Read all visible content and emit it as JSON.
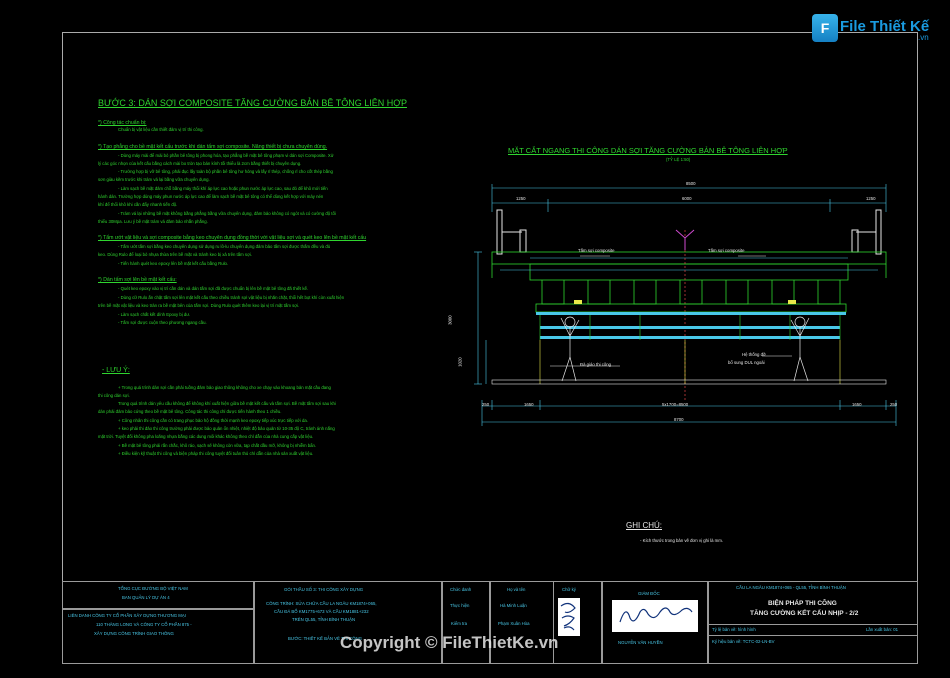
{
  "logo": {
    "mark": "F",
    "text": "File Thiết Kế",
    "suffix": ".vn"
  },
  "watermark": "Copyright © FileThietKe.vn",
  "left": {
    "heading": "BƯỚC 3: DÁN SỢI COMPOSITE TĂNG CƯỜNG BẢN BÊ TÔNG LIÊN HỢP",
    "s1_title": "*) Công tác chuẩn bị:",
    "s1_l1": "Chuẩn bị vật liệu cần thiết đảm vị trí thi công.",
    "s2_title": "*) Tạo phẳng cho bề mặt kết cấu trước khi dán tấm sợi composite. Năng thiết bị chưa chuyên dùng.",
    "s2_l1": "- Dùng máy mài để mài bỏ phần bê tông bị phong hóa, tạo phẳng bề mặt bê tông phạm vi dán sợi Composite. Xử",
    "s2_l2": "lý các góc nhọn của kết cấu bằng cách mài bo tròn tạo bán kính tối thiểu là 2cm bằng thiết bị chuyên dụng.",
    "s2_l3": "- Trường hợp bị vỡ bê tông, phải đục lấy toàn bộ phần bê tông hư hỏng và lấy rỉ thép, chống rỉ cho cốt thép bằng",
    "s2_l4": "sơn giàu kẽm trước khi trám vá lại bằng vữa chuyên dụng.",
    "s2_l5": "- Làm sạch bề mặt đảm chỗ bằng máy thổi khí áp lực cao hoặc phun nước áp lực cao, sau đó để khô mới tiến",
    "s2_l6": "hành dán. Trường hợp dùng máy phun nước áp lực cao để làm sạch bề mặt bê tông có thể dùng kết hợp với máy nén",
    "s2_l7": "khí để thổi khô khi cần đẩy nhanh tiến độ.",
    "s2_l8": "- Trám vá lại những bề mặt không bằng phẳng bằng vữa chuyên dụng, đảm bảo không có ngót và có cường độ tối",
    "s2_l9": "thiểu 30Mpa. Lưu ý bề mặt trám vá đảm bảo nhẵn phẳng.",
    "s3_title": "*) Tẩm ướt vật liệu và sợi composite bằng keo chuyên dụng đồng thời với vật liệu sợi và quét keo lên bề mặt kết cấu",
    "s3_l1": "- Tấm ướt tấm sợi bằng keo chuyên dụng sử dụng ru lô-lu chuyên dụng đảm bảo tấm sợi được thấm đều và đủ",
    "s3_l2": "keo. Dùng Rulo để loại bỏ nhựa thừa trên bề mặt và tránh keo bị xả trên tấm sợi.",
    "s3_l3": "- Tiến hành quét keo epoxy lên bề mặt kết cấu bằng Rulo.",
    "s4_title": "*) Dán tấm sợi lên bề mặt kết cấu:",
    "s4_l1": "- Quét keo epoxy vào vị trí cần dán và dán tấm sợi đã được chuẩn bị lên bề mặt bê tông đã thiết kế.",
    "s4_l2": "- Dùng cữ Rulo ấn chặt tấm sợi lên mặt kết cấu theo chiều tránh sợi vật liệu bị nhăn chặt, thổi hết bọt khí còn xuất hiện",
    "s4_l3": "trên bề mặt vật liệu và keo tràn ra bề mặt bên của tấm sợi. Dùng Rulo quét thêm keo lại vị trí mặt tấm sợi.",
    "s4_l4": "- Làm sạch chất kết dính Epoxy bị dư.",
    "s4_l5": "- Tấm sợi được cuộn theo phương ngang cầu.",
    "luuy_title": "- LƯU Ý:",
    "luuy_l1": "+ Trong quá trình dán sợi cần phải tuồng đảm bảo giao thông không cho xe chạy vào khoang bản mặt cầu đang",
    "luuy_l2": "thi công dán sợi.",
    "luuy_l3": "Trong quá trình dán yêu cầu không để không khí xuất hiện giữa bề mặt kết cấu và tấm sợi. Bề mặt tấm sợi sau khi",
    "luuy_l4": "dán phải đảm bảo cứng theo bề mặt bê tông. Công tác thi công chỉ được tiến hành theo 1 chiều.",
    "luuy_l5": "+ Công nhân thi công cần có trang phục bảo hộ đồng thời mạnh keo epoxy tiếp xúc trực tiếp với da.",
    "luuy_l6": "+ keo phải thi đảo thi công trường phải được bảo quản ổn nhiệt, nhiệt độ bảo quản từ 10-35 độ C, tránh ánh nắng",
    "luuy_l7": "mặt trời. Tuyệt đối không pha loãng nhựa bằng các dung môi khác không theo chỉ dẫn của nhà cung cấp vật liệu.",
    "luuy_l8": "+ Bề mặt bê tông phải rắn chắc, khô ráo, sạch sẽ không còn vữa, tạp chất dầu mỡ, không bị nhiễm bẩn.",
    "luuy_l9": "+ Điều kiện kỹ thuật thi công và biện pháp thi công tuyệt đối tuân thủ chỉ dẫn của nhà sản xuất vật liệu."
  },
  "right": {
    "title": "MẶT CẮT NGANG THI CÔNG DÁN SỢI TĂNG CƯỜNG BẢN BÊ TÔNG LIÊN HỢP",
    "scale": "(TỶ LỆ 1:50)",
    "dim_total": "8500",
    "dim_1250a": "1250",
    "dim_6000": "6000",
    "dim_1250b": "1250",
    "label_left": "Tấm sợi composite",
    "label_right": "Tấm sợi composite",
    "label_scaffold": "Đà giáo thi công",
    "label_support": "Hệ thống đỡ",
    "label_support2": "bổ sung DUL ngoài",
    "dim_3000": "3000",
    "dim_1020": "1020",
    "b_250a": "250",
    "b_1650a": "1650",
    "b_span": "5x1700=8500",
    "b_1650b": "1650",
    "b_250b": "250",
    "b_total": "8700"
  },
  "notes": {
    "title": "GHI CHÚ:",
    "line": "- Kích thước trong bản vẽ đơn vị ghi là mm."
  },
  "titleblock": {
    "c1_1": "TỔNG CỤC ĐƯỜNG BỘ VIỆT NAM",
    "c1_2": "BAN QUẢN LÝ DỰ ÁN 4",
    "c1_3": "LIÊN DANH CÔNG TY CỔ PHẦN XÂY DỰNG THƯƠNG MẠI",
    "c1_4": "110 THĂNG LONG VÀ CÔNG TY CỔ PHẦN 875 -",
    "c1_5": "XÂY DỰNG CÔNG TRÌNH GIAO THÔNG",
    "c2_1": "GÓI THẦU SỐ 3: THI CÔNG XÂY DỰNG",
    "c2_2": "CÔNG TRÌNH: SỬA CHỮA CẦU LA NGÂU KM1874+065,",
    "c2_3": "CẦU ĐÁ BỔ KM1775+673 VÀ CẦU KM1881+232",
    "c2_4": "TRÊN QL55, TỈNH BÌNH THUẬN",
    "c2_5": "BƯỚC: THIẾT KẾ BẢN VẼ THI CÔNG",
    "r1a": "Chức danh",
    "r1b": "Họ và tên",
    "r1c": "Chữ ký",
    "r2a": "Thực hiện",
    "r2b": "Hà Minh Luận",
    "r3a": "Kiểm tra",
    "r3b": "Phạm Xuân Hòa",
    "gd": "GIÁM ĐỐC",
    "gd_name": "NGUYỄN VĂN HUYỀN",
    "bridge": "CẦU LA NGÂU KM1874+065 - QL55, TỈNH BÌNH THUẬN",
    "dw1": "BIỆN PHÁP THI CÔNG",
    "dw2": "TĂNG CƯỜNG KẾT CẤU NHỊP - 2/2",
    "ref1": "Tỷ lệ bản vẽ: hình hình",
    "ref2": "Lần xuất bản: 01",
    "ref3": "Ký hiệu bản vẽ: TCTC-02-LN-BV"
  },
  "colors": {
    "bg": "#000000",
    "green": "#2fd52f",
    "yellow": "#e8e84a",
    "cyan": "#49c8e8",
    "red": "#e04646",
    "magenta": "#d04ad0"
  }
}
